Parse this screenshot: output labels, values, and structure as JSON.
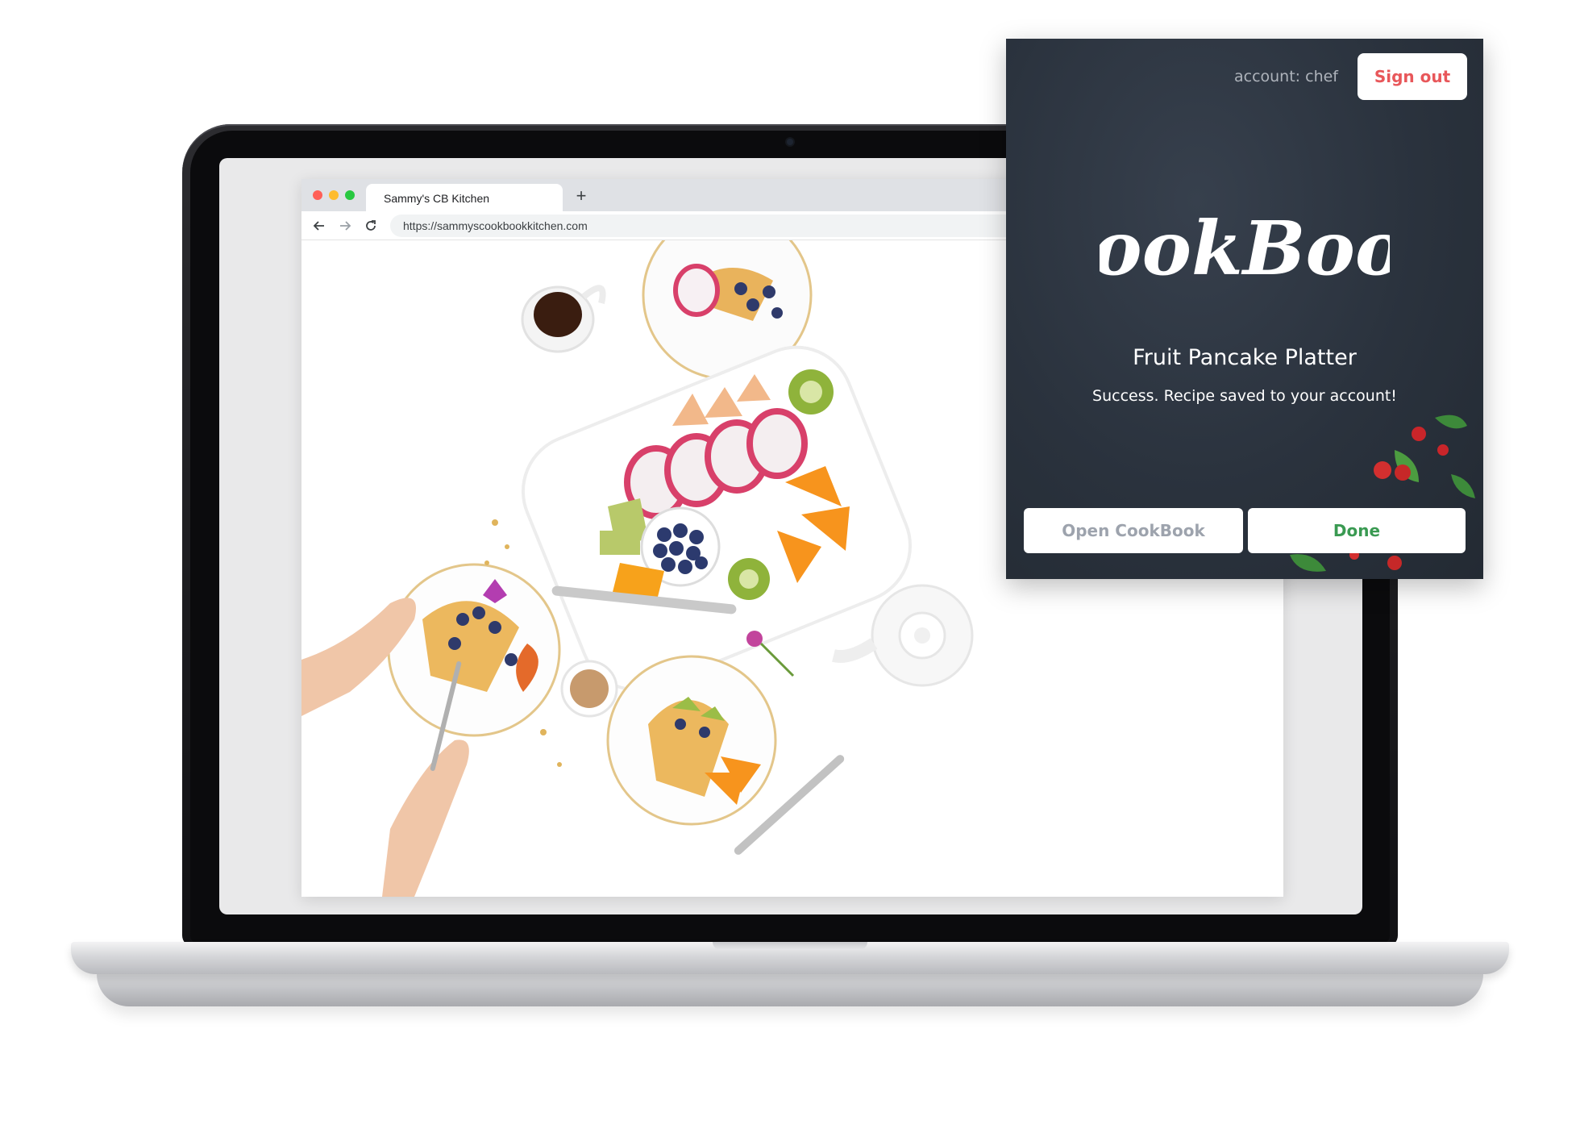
{
  "browser": {
    "tab_title": "Sammy's CB Kitchen",
    "new_tab_label": "+",
    "url": "https://sammyscookbookkitchen.com",
    "icons": [
      "back-arrow-icon",
      "forward-arrow-icon",
      "reload-icon"
    ]
  },
  "cookbook_panel": {
    "account_label": "account: chef",
    "sign_out_label": "Sign out",
    "logo_text": "CookBook",
    "recipe_title": "Fruit Pancake Platter",
    "message": "Success. Recipe saved to your account!",
    "open_button_label": "Open CookBook",
    "done_button_label": "Done"
  },
  "colors": {
    "panel_background": "#2a323d",
    "sign_out_text": "#e8575a",
    "done_text": "#3a9a52",
    "open_text": "#9da3ad"
  }
}
